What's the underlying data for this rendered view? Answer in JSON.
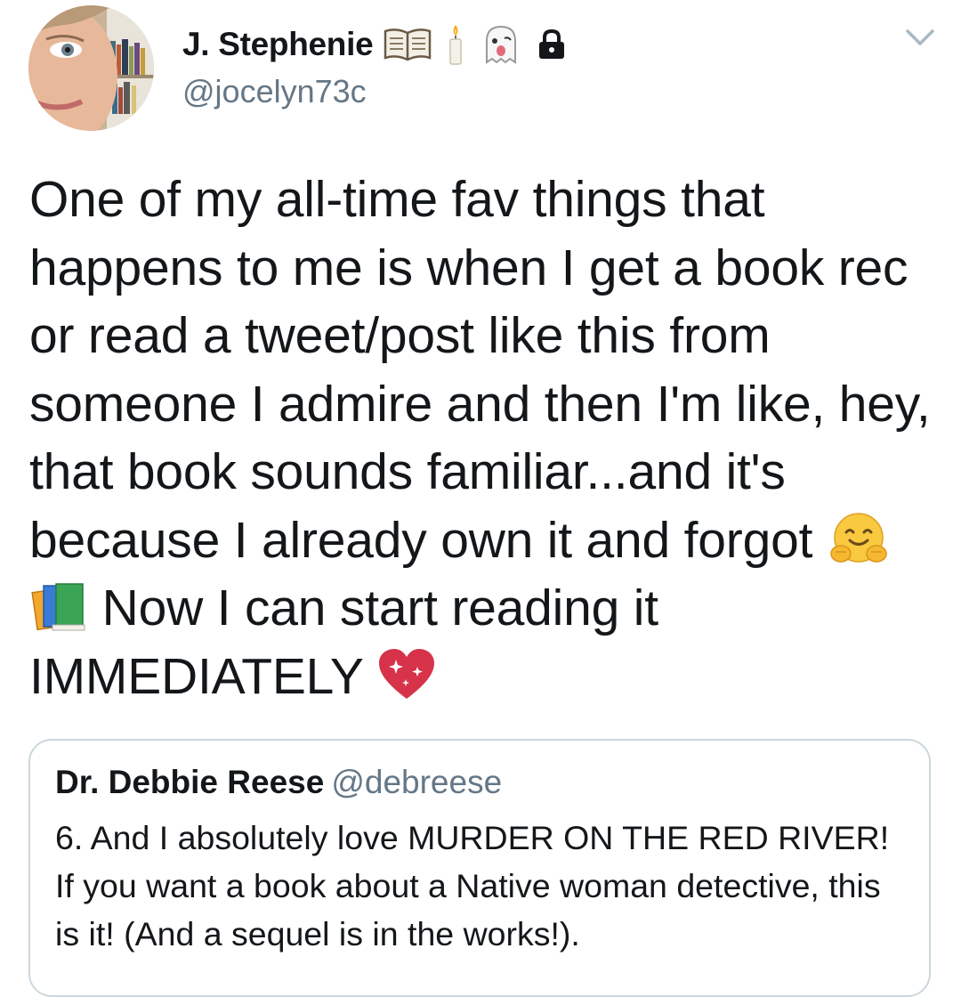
{
  "tweet": {
    "author": {
      "display_name": "J. Stephenie",
      "handle": "@jocelyn73c",
      "name_icons": [
        "open-book-icon",
        "candle-icon",
        "ghost-icon",
        "lock-icon"
      ]
    },
    "menu_icon": "chevron-down-icon",
    "text": {
      "part1": "One of my all-time fav things that happens to me is when I get a book rec or read a tweet/post like this from someone I admire and then I'm like, hey, that book sounds familiar...and it's because I already own it and forgot ",
      "emojis_mid": [
        "hugging-face-icon",
        "books-icon"
      ],
      "part2": " Now I can start reading it IMMEDIATELY ",
      "emoji_end": "sparkling-heart-icon"
    },
    "quoted": {
      "name": "Dr. Debbie Reese",
      "handle": "@debreese",
      "text": "6. And I absolutely love MURDER ON THE RED RIVER! If you want a book about a Native woman detective, this is it! (And a sequel is in the works!)."
    }
  },
  "colors": {
    "text_primary": "#14171a",
    "text_secondary": "#657786",
    "card_border": "#ccd6dd",
    "caret": "#aab8c2"
  }
}
